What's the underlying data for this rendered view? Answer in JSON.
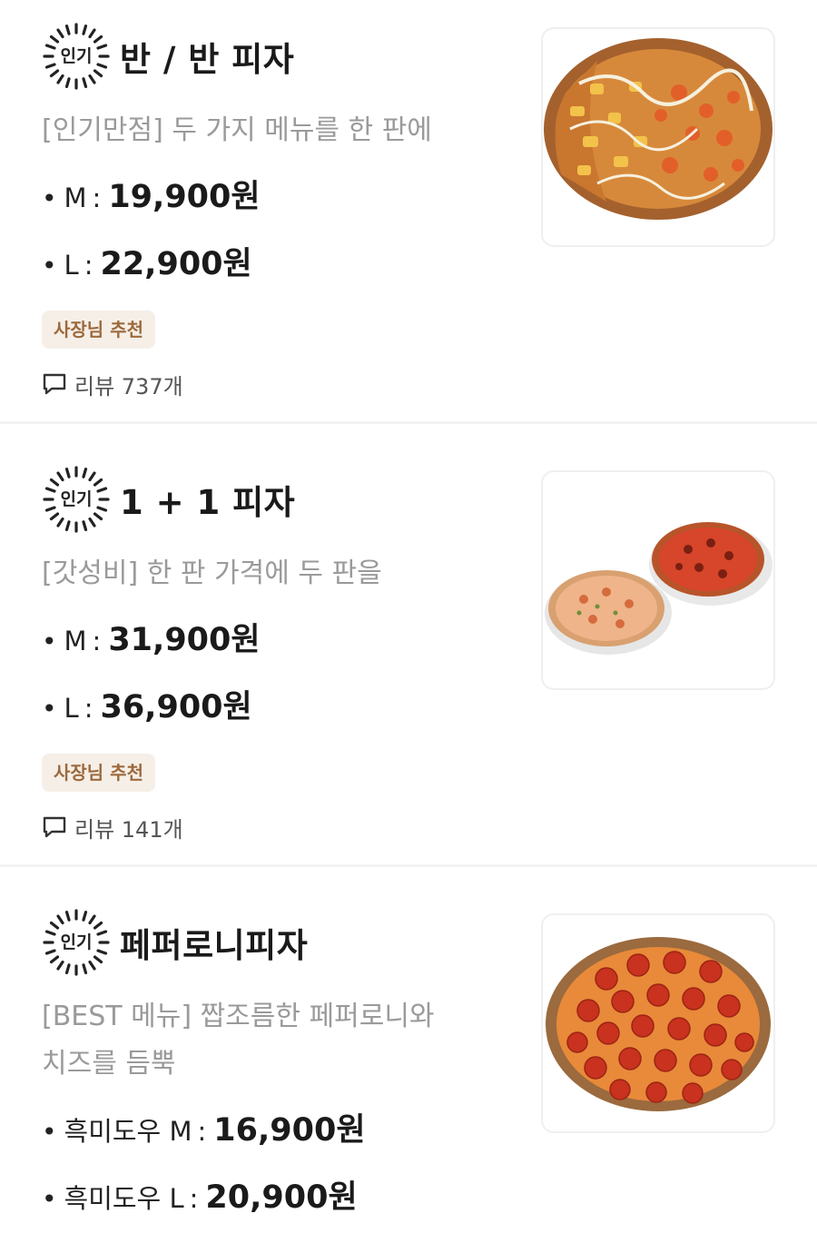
{
  "popular_label": "인기",
  "recommend_label": "사장님 추천",
  "items": [
    {
      "name": "반 / 반 피자",
      "description": "[인기만점] 두 가지 메뉴를 한 판에",
      "prices": [
        {
          "label": "M",
          "value": "19,900원"
        },
        {
          "label": "L",
          "value": "22,900원"
        }
      ],
      "review": "리뷰 737개"
    },
    {
      "name": "1 + 1 피자",
      "description": "[갓성비] 한 판 가격에 두 판을",
      "prices": [
        {
          "label": "M",
          "value": "31,900원"
        },
        {
          "label": "L",
          "value": "36,900원"
        }
      ],
      "review": "리뷰 141개"
    },
    {
      "name": "페퍼로니피자",
      "description_line1": "[BEST 메뉴] 짭조름한 페퍼로니와",
      "description_line2": "치즈를 듬뿍",
      "prices": [
        {
          "label": "흑미도우 M",
          "value": "16,900원"
        },
        {
          "label": "흑미도우 L",
          "value": "20,900원"
        }
      ]
    }
  ],
  "colors": {
    "recommend_bg": "#f6efe7",
    "recommend_text": "#9c6a3d",
    "description_text": "#9a9a9a"
  },
  "icons": {
    "popular": "sunburst-badge-icon",
    "review": "speech-bubble-icon"
  }
}
